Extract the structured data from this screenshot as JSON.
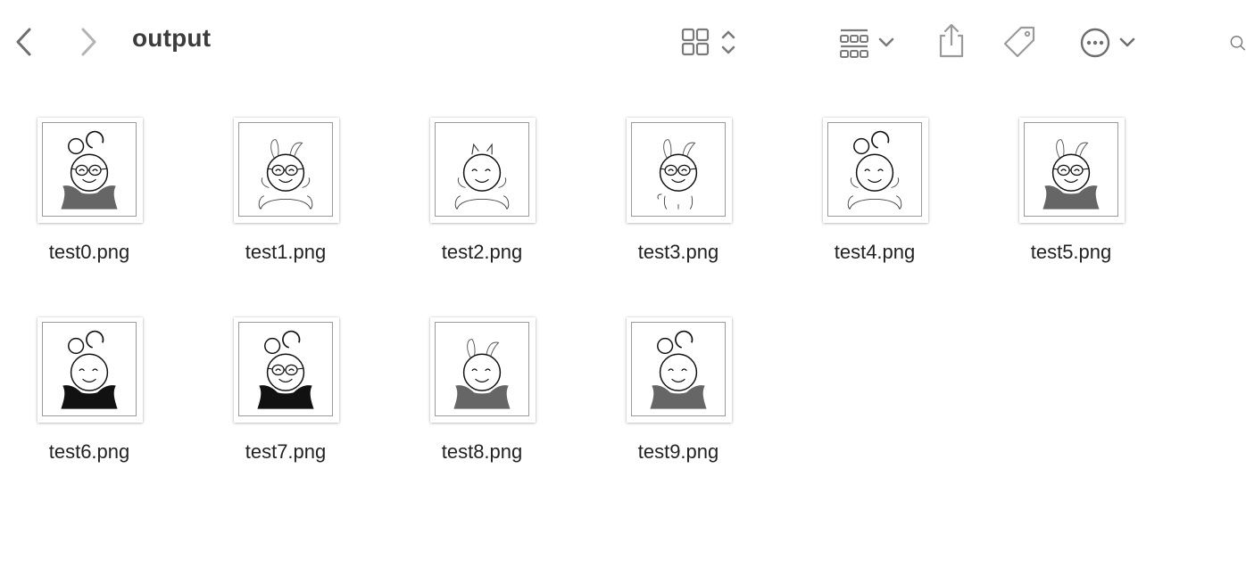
{
  "window": {
    "title": "output"
  },
  "toolbar": {
    "back_icon": "chevron-left-icon",
    "forward_icon": "chevron-right-icon",
    "view_icon": "grid-view-icon",
    "group_icon": "group-by-icon",
    "share_icon": "share-icon",
    "tag_icon": "tag-icon",
    "more_icon": "ellipsis-circle-icon",
    "search_icon": "search-icon"
  },
  "files": [
    {
      "name": "test0.png",
      "ears": "round",
      "glasses": true,
      "body": "gray"
    },
    {
      "name": "test1.png",
      "ears": "bunny",
      "glasses": true,
      "body": "arms"
    },
    {
      "name": "test2.png",
      "ears": "cat",
      "glasses": false,
      "body": "arms"
    },
    {
      "name": "test3.png",
      "ears": "bunny",
      "glasses": true,
      "body": "small"
    },
    {
      "name": "test4.png",
      "ears": "round",
      "glasses": false,
      "body": "arms"
    },
    {
      "name": "test5.png",
      "ears": "bunny",
      "glasses": true,
      "body": "gray"
    },
    {
      "name": "test6.png",
      "ears": "round",
      "glasses": false,
      "body": "black"
    },
    {
      "name": "test7.png",
      "ears": "round",
      "glasses": true,
      "body": "black"
    },
    {
      "name": "test8.png",
      "ears": "bunny",
      "glasses": false,
      "body": "gray"
    },
    {
      "name": "test9.png",
      "ears": "round",
      "glasses": false,
      "body": "gray"
    }
  ],
  "colors": {
    "icon": "#8a8a8a",
    "icon_dark": "#6e6e6e",
    "text": "#222222",
    "gray_body": "#666666",
    "black_body": "#111111"
  }
}
